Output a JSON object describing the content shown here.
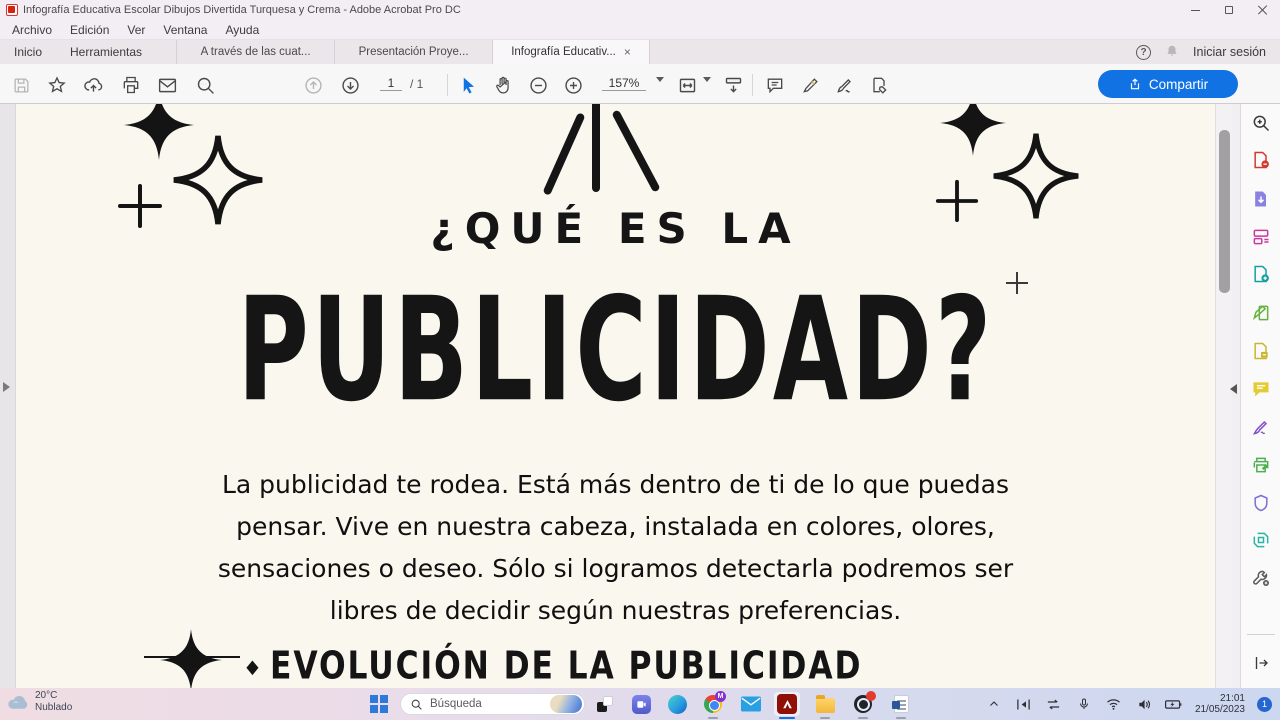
{
  "window": {
    "title": "Infografía Educativa Escolar Dibujos Divertida Turquesa y Crema - Adobe Acrobat Pro DC"
  },
  "menubar": {
    "items": [
      "Archivo",
      "Edición",
      "Ver",
      "Ventana",
      "Ayuda"
    ]
  },
  "tabbar": {
    "home": "Inicio",
    "tools": "Herramientas",
    "doc_tabs": [
      "A través de las cuat...",
      "Presentación Proye...",
      "Infografía Educativ..."
    ],
    "close_glyph": "×",
    "help_glyph": "?",
    "sign_in": "Iniciar sesión"
  },
  "toolbar": {
    "page_current": "1",
    "page_total": "/ 1",
    "zoom": "157%",
    "share": "Compartir"
  },
  "page": {
    "kicker": "¿QUÉ ES LA",
    "title": "PUBLICIDAD?",
    "body_lines": [
      "La publicidad te rodea. Está más dentro de ti de lo que puedas",
      "pensar. Vive en nuestra cabeza, instalada en colores, olores,",
      "sensaciones o deseo. Sólo si logramos detectarla podremos ser",
      "libres de decidir según nuestras preferencias."
    ],
    "section": "EVOLUCIÓN DE LA PUBLICIDAD"
  },
  "taskbar": {
    "weather": {
      "temp": "20°C",
      "condition": "Nublado"
    },
    "search_placeholder": "Búsqueda",
    "gmail_badge": "M",
    "clock": {
      "time": "21:01",
      "date": "21/05/2023"
    },
    "notification_count": "1"
  },
  "colors": {
    "accent_blue": "#1172e4",
    "acrobat_red": "#c3190b",
    "page_cream": "#faf7ee",
    "taskbar_left": "#f0dde3",
    "taskbar_right": "#ccd7f0"
  }
}
